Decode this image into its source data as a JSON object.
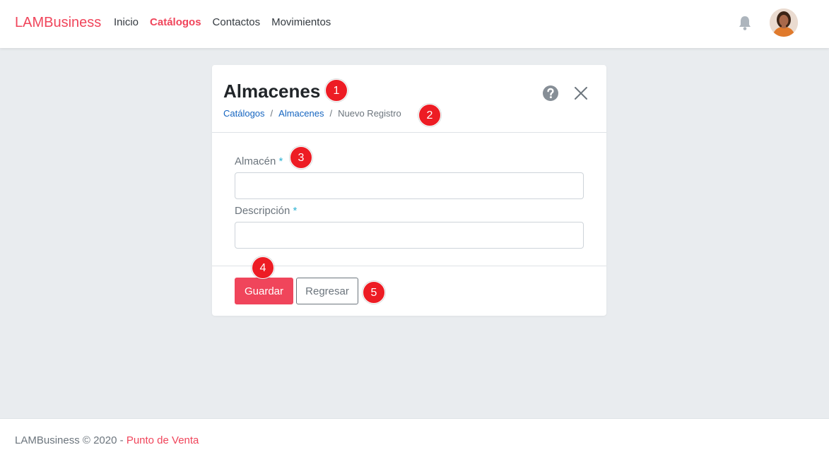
{
  "navbar": {
    "brand": "LAMBusiness",
    "links": [
      {
        "label": "Inicio",
        "active": false
      },
      {
        "label": "Catálogos",
        "active": true
      },
      {
        "label": "Contactos",
        "active": false
      },
      {
        "label": "Movimientos",
        "active": false
      }
    ],
    "icons": {
      "notifications": "bell-icon",
      "user": "avatar"
    }
  },
  "card": {
    "title": "Almacenes",
    "breadcrumb": {
      "items": [
        "Catálogos",
        "Almacenes",
        "Nuevo Registro"
      ],
      "separator": "/"
    },
    "actions": {
      "help": "question-circle-icon",
      "close": "close-icon"
    },
    "form": {
      "fields": [
        {
          "label": "Almacén",
          "required_mark": "*",
          "value": "",
          "placeholder": ""
        },
        {
          "label": "Descripción",
          "required_mark": "*",
          "value": "",
          "placeholder": ""
        }
      ]
    },
    "buttons": {
      "save": "Guardar",
      "back": "Regresar"
    }
  },
  "markers": [
    "1",
    "2",
    "3",
    "4",
    "5"
  ],
  "footer": {
    "text": "LAMBusiness © 2020 -",
    "link": "Punto de Venta"
  },
  "colors": {
    "accent": "#f0455b",
    "link": "#1565c0",
    "required": "#30b4d4",
    "marker": "#ed1c24",
    "background": "#e9ecef"
  }
}
